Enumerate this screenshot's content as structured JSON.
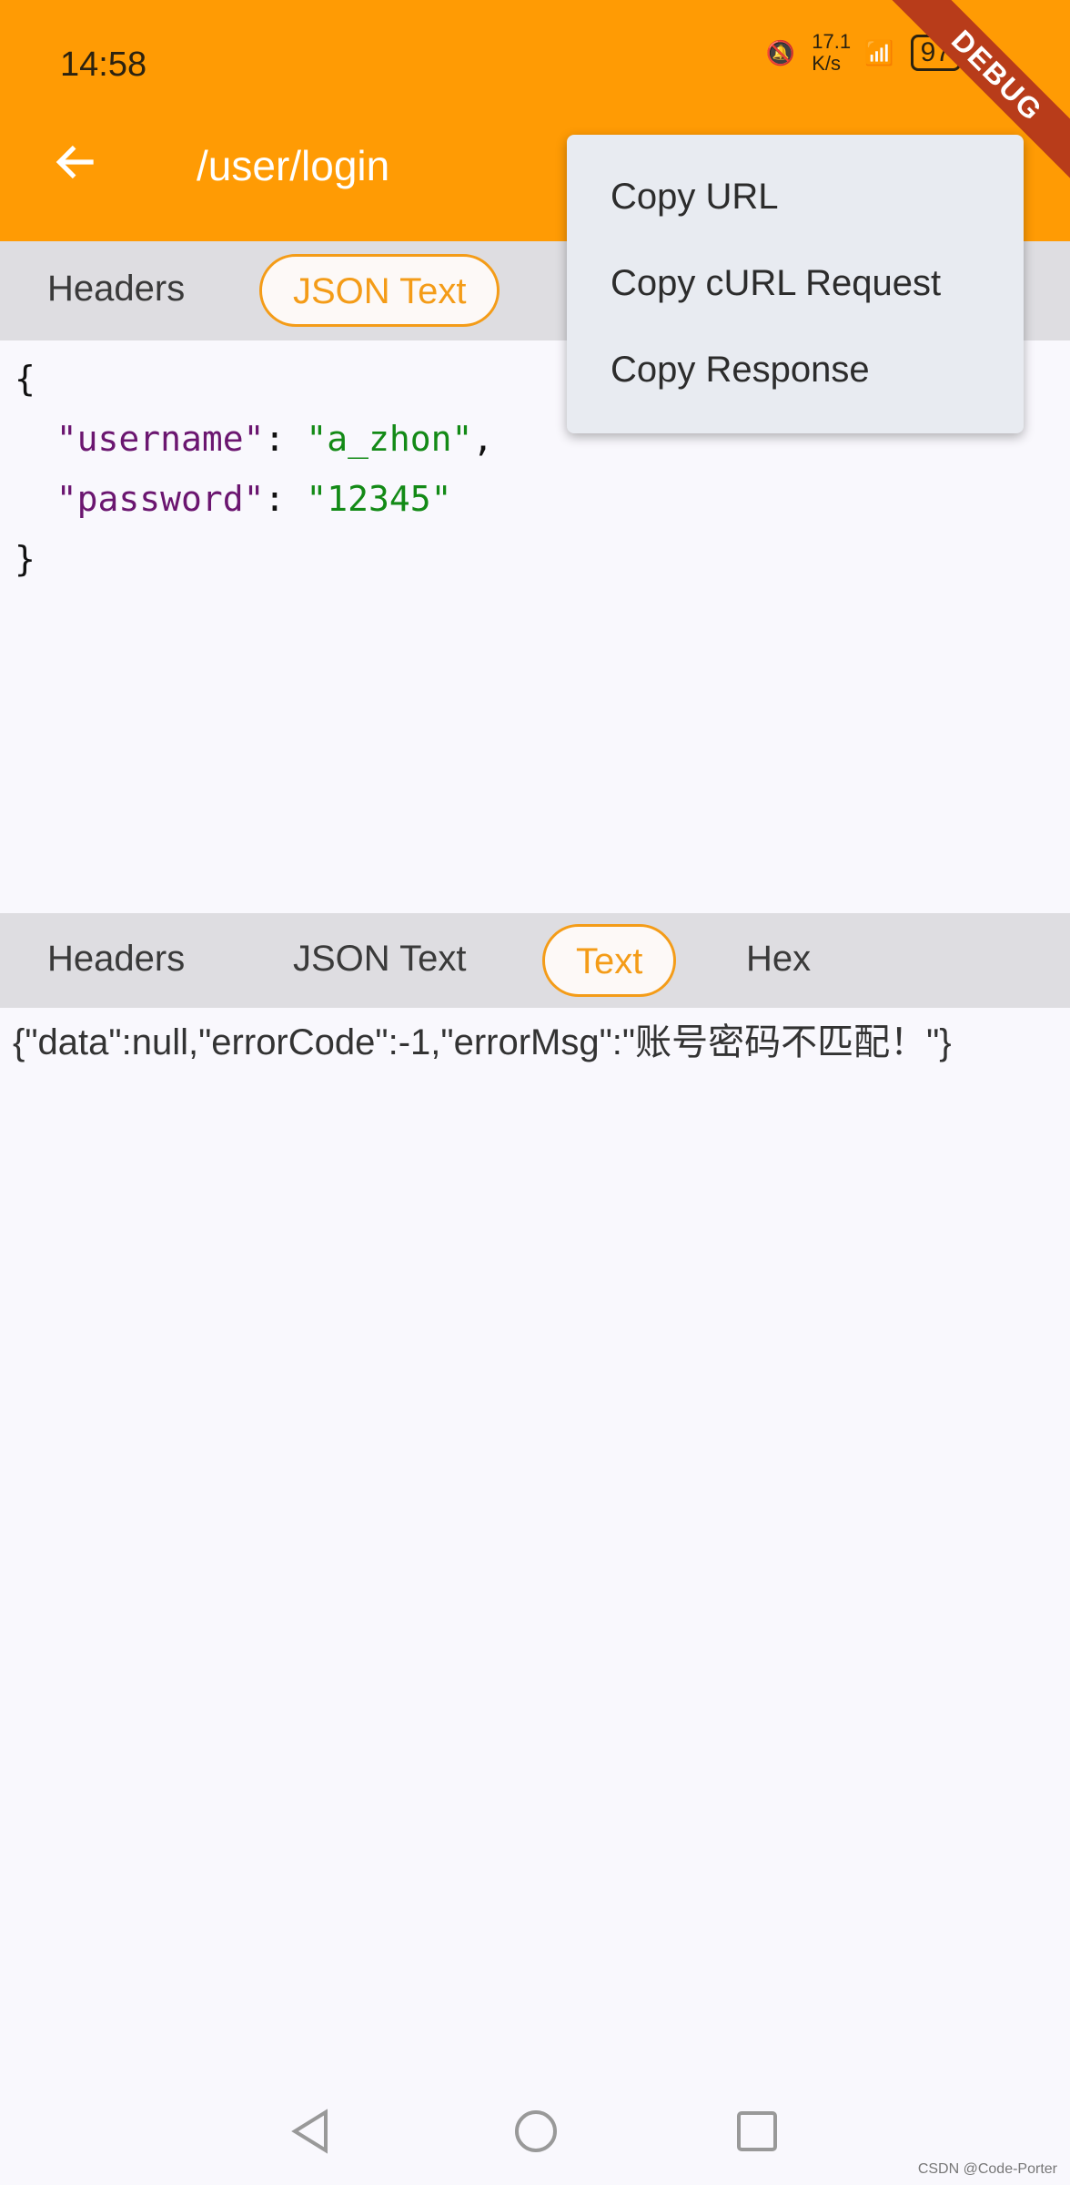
{
  "status_bar": {
    "time": "14:58",
    "net_speed": "17.1 K/s",
    "battery": "97"
  },
  "app_bar": {
    "title": "/user/login",
    "debug_banner": "DEBUG"
  },
  "request": {
    "tabs": [
      "Headers",
      "JSON Text"
    ],
    "active_tab": "JSON Text",
    "json_lines": [
      {
        "key": "\"username\"",
        "value": "\"a_zhon\""
      },
      {
        "key": "\"password\"",
        "value": "\"12345\""
      }
    ]
  },
  "response": {
    "tabs": [
      "Headers",
      "JSON Text",
      "Text",
      "Hex"
    ],
    "active_tab": "Text",
    "text": "{\"data\":null,\"errorCode\":-1,\"errorMsg\":\"账号密码不匹配！\"}"
  },
  "menu": {
    "items": [
      "Copy URL",
      "Copy cURL Request",
      "Copy Response"
    ]
  },
  "watermark": "CSDN @Code-Porter",
  "colors": {
    "accent": "#ff9b04",
    "active_tab": "#f49c18"
  }
}
